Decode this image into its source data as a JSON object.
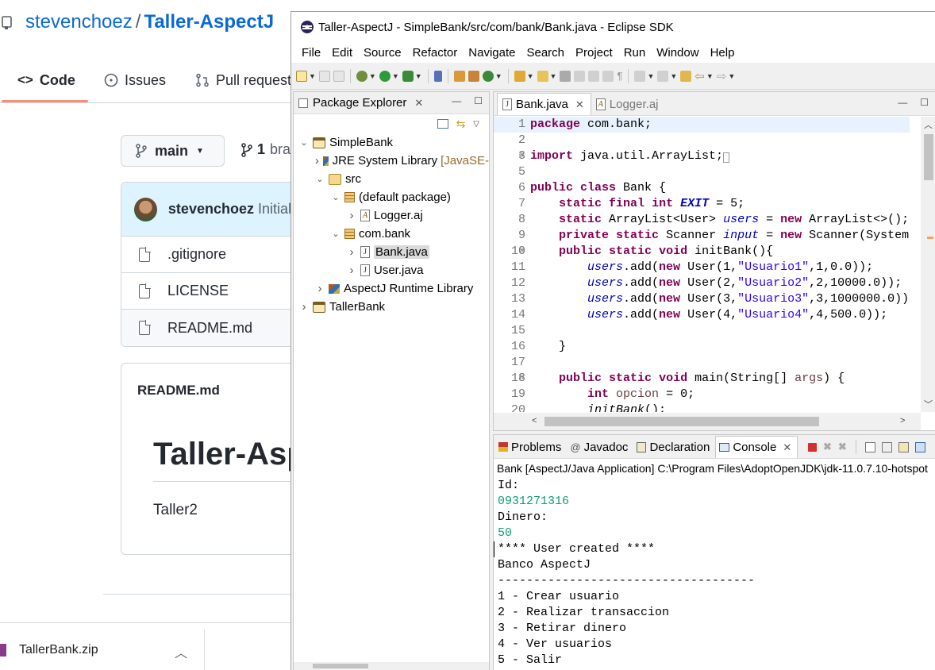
{
  "github": {
    "owner": "stevenchoez",
    "separator": "/",
    "repo": "Taller-AspectJ",
    "tabs": [
      {
        "label": "Code"
      },
      {
        "label": "Issues"
      },
      {
        "label": "Pull request"
      }
    ],
    "branch": "main",
    "branches_count": "1",
    "branches_label": "bra",
    "commit": {
      "author": "stevenchoez",
      "message": "Initial c"
    },
    "files": [
      {
        "name": ".gitignore"
      },
      {
        "name": "LICENSE"
      },
      {
        "name": "README.md"
      }
    ],
    "readme": {
      "header": "README.md",
      "title": "Taller-Asp",
      "body": "Taller2"
    },
    "download": {
      "file": "TallerBank.zip"
    },
    "colors": {
      "link": "#0969da",
      "tab_underline": "#fd8c73"
    }
  },
  "eclipse": {
    "window_title": "Taller-AspectJ - SimpleBank/src/com/bank/Bank.java - Eclipse SDK",
    "menu": [
      "File",
      "Edit",
      "Source",
      "Refactor",
      "Navigate",
      "Search",
      "Project",
      "Run",
      "Window",
      "Help"
    ],
    "package_explorer": {
      "title": "Package Explorer",
      "tree": [
        {
          "label": "SimpleBank",
          "icon": "project-icon",
          "indent": 0,
          "twisty": "expanded"
        },
        {
          "label": "JRE System Library",
          "suffix": "[JavaSE-",
          "icon": "library-icon",
          "indent": 1,
          "twisty": "collapsed"
        },
        {
          "label": "src",
          "icon": "folder-icon",
          "indent": 1,
          "twisty": "expanded"
        },
        {
          "label": "(default package)",
          "icon": "package-icon",
          "indent": 2,
          "twisty": "expanded"
        },
        {
          "label": "Logger.aj",
          "icon": "aj-file-icon",
          "indent": 3,
          "twisty": "collapsed"
        },
        {
          "label": "com.bank",
          "icon": "package-icon",
          "indent": 2,
          "twisty": "expanded"
        },
        {
          "label": "Bank.java",
          "icon": "java-file-icon",
          "indent": 3,
          "twisty": "collapsed",
          "selected": true
        },
        {
          "label": "User.java",
          "icon": "java-file-icon",
          "indent": 3,
          "twisty": "collapsed"
        },
        {
          "label": "AspectJ Runtime Library",
          "icon": "library-icon",
          "indent": 1,
          "twisty": "collapsed"
        },
        {
          "label": "TallerBank",
          "icon": "project-icon",
          "indent": 0,
          "twisty": "collapsed"
        }
      ]
    },
    "editor": {
      "tabs": [
        {
          "label": "Bank.java",
          "active": true
        },
        {
          "label": "Logger.aj",
          "active": false
        }
      ],
      "lines": [
        {
          "n": "1",
          "html": "<span class=\"kw\">package</span> com.bank;",
          "current": true
        },
        {
          "n": "2",
          "html": ""
        },
        {
          "n": "3",
          "html": "<span class=\"kw\">import</span> java.util.ArrayList;<span style=\"border:1px solid #999;color:#999;font-size:10px\">&nbsp;</span>",
          "fold": "⊕"
        },
        {
          "n": "5",
          "html": ""
        },
        {
          "n": "6",
          "html": "<span class=\"kw\">public</span> <span class=\"kw\">class</span> Bank {"
        },
        {
          "n": "7",
          "html": "    <span class=\"kw\">static</span> <span class=\"kw\">final</span> <span class=\"kw\">int</span> <span class=\"stc\">EXIT</span> = 5;"
        },
        {
          "n": "8",
          "html": "    <span class=\"kw\">static</span> ArrayList&lt;User&gt; <span class=\"fld\">users</span> = <span class=\"kw\">new</span> ArrayList&lt;&gt;();"
        },
        {
          "n": "9",
          "html": "    <span class=\"kw\">private</span> <span class=\"kw\">static</span> Scanner <span class=\"fld\">input</span> = <span class=\"kw\">new</span> Scanner(System"
        },
        {
          "n": "10",
          "html": "    <span class=\"kw\">public</span> <span class=\"kw\">static</span> <span class=\"kw\">void</span> initBank(){",
          "fold": "⊖"
        },
        {
          "n": "11",
          "html": "        <span class=\"fld\">users</span>.add(<span class=\"kw\">new</span> User(1,<span class=\"str\">\"Usuario1\"</span>,1,0.0));"
        },
        {
          "n": "12",
          "html": "        <span class=\"fld\">users</span>.add(<span class=\"kw\">new</span> User(2,<span class=\"str\">\"Usuario2\"</span>,2,10000.0));"
        },
        {
          "n": "13",
          "html": "        <span class=\"fld\">users</span>.add(<span class=\"kw\">new</span> User(3,<span class=\"str\">\"Usuario3\"</span>,3,1000000.0))"
        },
        {
          "n": "14",
          "html": "        <span class=\"fld\">users</span>.add(<span class=\"kw\">new</span> User(4,<span class=\"str\">\"Usuario4\"</span>,4,500.0));"
        },
        {
          "n": "15",
          "html": ""
        },
        {
          "n": "16",
          "html": "    }"
        },
        {
          "n": "17",
          "html": ""
        },
        {
          "n": "18",
          "html": "    <span class=\"kw\">public</span> <span class=\"kw\">static</span> <span class=\"kw\">void</span> main(String[] <span class=\"par\">args</span>) {",
          "fold": "⊖"
        },
        {
          "n": "19",
          "html": "        <span class=\"kw\">int</span> <span class=\"par\">opcion</span> = 0;"
        },
        {
          "n": "20",
          "html": "        <span style=\"font-style:italic\">initBank</span>();"
        }
      ]
    },
    "console": {
      "tabs": [
        {
          "label": "Problems",
          "icon": "problems-icon"
        },
        {
          "label": "Javadoc",
          "icon": "javadoc-icon"
        },
        {
          "label": "Declaration",
          "icon": "declaration-icon"
        },
        {
          "label": "Console",
          "icon": "console-icon",
          "active": true
        }
      ],
      "header": "Bank [AspectJ/Java Application] C:\\Program Files\\AdoptOpenJDK\\jdk-11.0.7.10-hotspot",
      "lines": [
        {
          "text": "Id:",
          "input": false
        },
        {
          "text": "0931271316",
          "input": true
        },
        {
          "text": "Dinero:",
          "input": false
        },
        {
          "text": "50",
          "input": true
        },
        {
          "text": "**** User created ****",
          "input": false
        },
        {
          "text": "Banco AspectJ",
          "input": false
        },
        {
          "text": "------------------------------------",
          "input": false
        },
        {
          "text": "1 - Crear usuario",
          "input": false
        },
        {
          "text": "2 - Realizar transaccion",
          "input": false
        },
        {
          "text": "3 - Retirar dinero",
          "input": false
        },
        {
          "text": "4 - Ver usuarios",
          "input": false
        },
        {
          "text": "5 - Salir",
          "input": false
        }
      ],
      "colors": {
        "input": "#0f9d7a",
        "terminate": "#d32f2f"
      }
    }
  }
}
